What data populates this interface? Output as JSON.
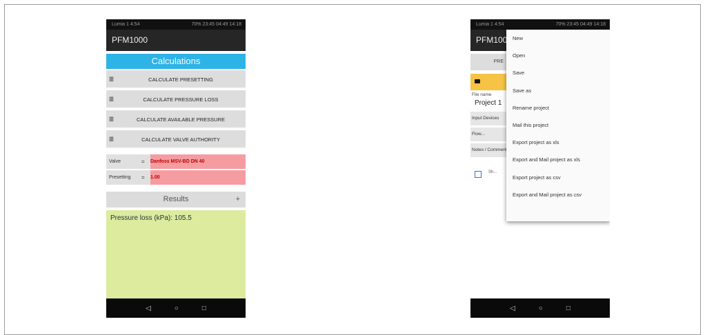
{
  "left_phone": {
    "status_left": "Lumia 1 4:54",
    "status_right": "70% 23:45 04:49 14:18",
    "app_title": "PFM1000",
    "calculations_title": "Calculations",
    "calc_buttons": [
      "CALCULATE PRESETTING",
      "CALCULATE PRESSURE LOSS",
      "CALCULATE AVAILABLE PRESSURE",
      "CALCULATE VALVE AUTHORITY"
    ],
    "fields": [
      {
        "label": "Valve",
        "value": "Danfoss MSV-BD DN 40"
      },
      {
        "label": "Presetting",
        "value": "1.00"
      }
    ],
    "results_label": "Results",
    "results_plus": "+",
    "result_text": "Pressure loss (kPa): 105.5"
  },
  "right_phone": {
    "status_left": "Lumia 1 4:54",
    "status_right": "70% 23:45 04:49 14:18",
    "app_title": "PFM1000",
    "bg_button": "PRE",
    "bg_filename_label": "File name",
    "bg_project": "Project 1",
    "bg_input_label": "Input Devices",
    "bg_flow_label": "Flow...",
    "bg_notes_label": "Notes / Comments",
    "bg_check_label": "Sh...",
    "menu_items": [
      "New",
      "Open",
      "Save",
      "Save as",
      "Rename project",
      "Mail this project",
      "Export project as xls",
      "Export and Mail project as xls",
      "Export project as csv",
      "Export and Mail project as csv"
    ]
  },
  "nav": {
    "back": "◁",
    "home": "○",
    "recent": "□"
  },
  "colors": {
    "calc_header": "#2eb3e6",
    "field_value_bg": "#f59ca1",
    "field_value_text": "#c00000",
    "results_bg": "#dceb9d",
    "appbar": "#262626",
    "highlight_row": "#f6c344"
  }
}
